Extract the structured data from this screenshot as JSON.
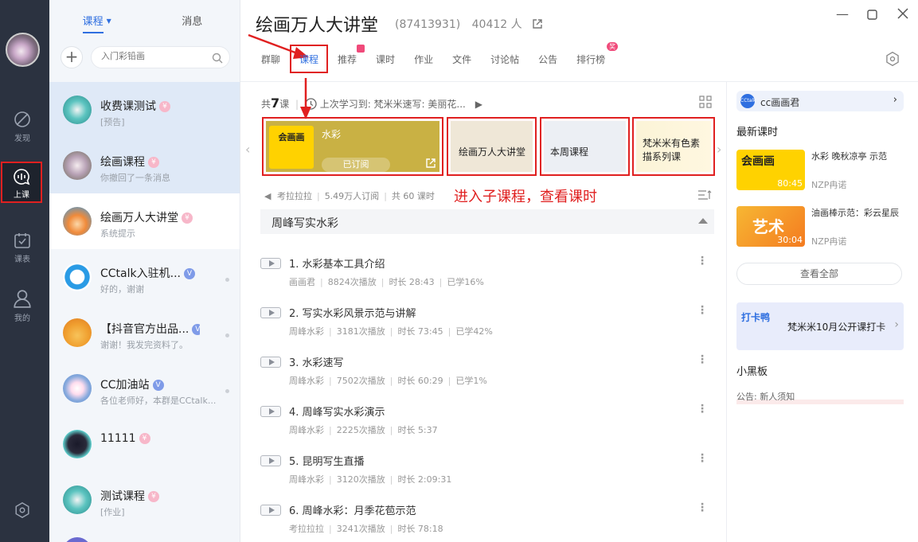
{
  "navbar": {
    "items": [
      {
        "label": "发现",
        "icon": "discover-icon"
      },
      {
        "label": "上课",
        "icon": "class-mic-icon"
      },
      {
        "label": "课表",
        "icon": "schedule-icon"
      },
      {
        "label": "我的",
        "icon": "profile-icon"
      }
    ]
  },
  "sidebar": {
    "tabs": [
      "课程",
      "消息"
    ],
    "search_placeholder": "入门彩铅画",
    "conversations": [
      {
        "name": "收费课测试",
        "badge": "¥",
        "sub": "[预告]"
      },
      {
        "name": "绘画课程",
        "badge": "¥",
        "sub": "你撤回了一条消息"
      },
      {
        "name": "绘画万人大讲堂",
        "badge": "¥",
        "sub": "系统提示"
      },
      {
        "name": "CCtalk入驻机...",
        "badge": "V",
        "sub": "好的，谢谢"
      },
      {
        "name": "【抖音官方出品...",
        "badge": "V",
        "sub": "谢谢！我发完资料了。"
      },
      {
        "name": "CC加油站",
        "badge": "V",
        "sub": "各位老师好，本群是CCtalk..."
      },
      {
        "name": "11111",
        "badge": "¥",
        "sub": ""
      },
      {
        "name": "测试课程",
        "badge": "¥",
        "sub": "[作业]"
      }
    ]
  },
  "header": {
    "title": "绘画万人大讲堂",
    "group_id": "(87413931)",
    "member_count": "40412 人",
    "tabs": [
      {
        "label": "群聊"
      },
      {
        "label": "课程"
      },
      {
        "label": "推荐"
      },
      {
        "label": "课时"
      },
      {
        "label": "作业"
      },
      {
        "label": "文件"
      },
      {
        "label": "讨论帖"
      },
      {
        "label": "公告"
      },
      {
        "label": "排行榜"
      }
    ],
    "hot_badge": "奖"
  },
  "courses": {
    "total_prefix": "共",
    "total_count": "7",
    "total_suffix": "课",
    "last_learned": "上次学习到: 梵米米速写: 美丽花...",
    "cards": [
      {
        "label": "水彩",
        "status": "已订阅",
        "thumb_text": "会画画"
      },
      {
        "label": "绘画万人大讲堂"
      },
      {
        "label": "本周课程"
      },
      {
        "label": "梵米米有色素描系列课"
      }
    ],
    "meta": {
      "teacher": "考拉拉拉",
      "subscribers": "5.49万人订阅",
      "lesson_count": "共 60 课时"
    },
    "annotation": "进入子课程，查看课时",
    "section_title": "周峰写实水彩",
    "lessons": [
      {
        "title": "1. 水彩基本工具介绍",
        "author": "画画君",
        "plays": "8824次播放",
        "duration": "时长 28:43",
        "progress": "已学16%"
      },
      {
        "title": "2. 写实水彩风景示范与讲解",
        "author": "周峰水彩",
        "plays": "3181次播放",
        "duration": "时长 73:45",
        "progress": "已学42%"
      },
      {
        "title": "3. 水彩速写",
        "author": "周峰水彩",
        "plays": "7502次播放",
        "duration": "时长 60:29",
        "progress": "已学1%"
      },
      {
        "title": "4. 周峰写实水彩演示",
        "author": "周峰水彩",
        "plays": "2225次播放",
        "duration": "时长 5:37",
        "progress": ""
      },
      {
        "title": "5. 昆明写生直播",
        "author": "周峰水彩",
        "plays": "3120次播放",
        "duration": "时长 2:09:31",
        "progress": ""
      },
      {
        "title": "6. 周峰水彩：月季花苞示范",
        "author": "考拉拉拉",
        "plays": "3241次播放",
        "duration": "时长 78:18",
        "progress": ""
      }
    ]
  },
  "right_panel": {
    "cc_name": "cc画画君",
    "cc_logo": "CCtalk",
    "latest_title": "最新课时",
    "latest": [
      {
        "title": "水彩 晚秋凉亭 示范",
        "author": "NZP冉诺",
        "duration": "80:45",
        "thumb_text": "会画画"
      },
      {
        "title": "油画棒示范：彩云星辰",
        "author": "NZP冉诺",
        "duration": "30:04",
        "thumb_text": "艺术"
      }
    ],
    "view_all": "查看全部",
    "banner_text": "梵米米10月公开课打卡",
    "banner_badge": "打卡鸭",
    "blackboard_title": "小黑板",
    "blackboard_note": "公告: 新人须知"
  },
  "colors": {
    "accent": "#2f6fe0",
    "highlight_red": "#e02020",
    "sidebar_dark": "#2b3240"
  }
}
